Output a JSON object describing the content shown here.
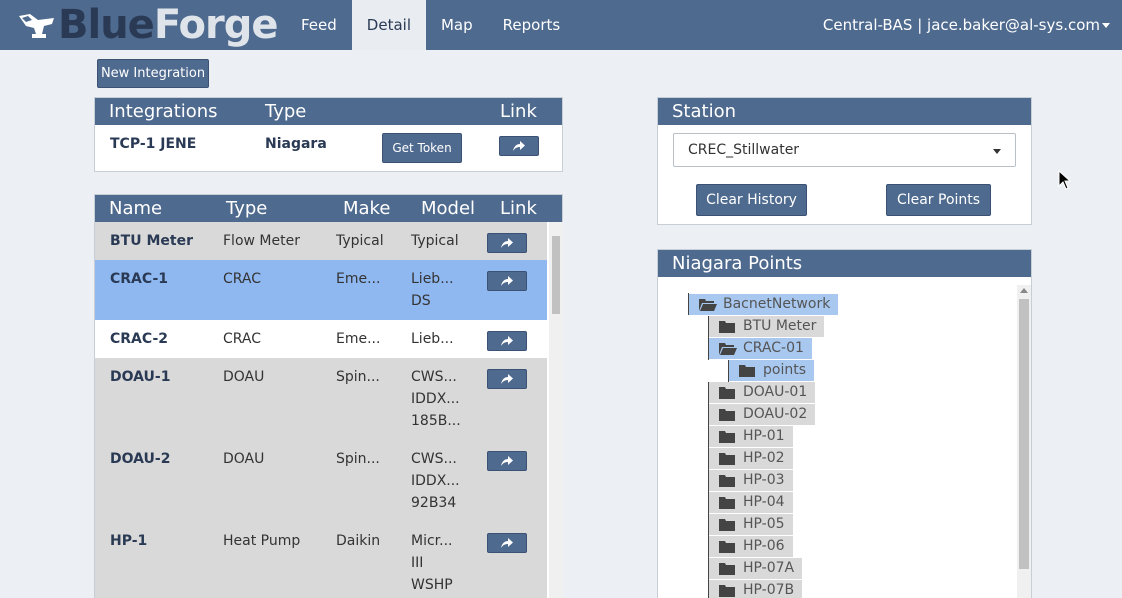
{
  "brand": {
    "part1": "Blue",
    "part2": "Forge"
  },
  "nav": {
    "tabs": [
      {
        "label": "Feed"
      },
      {
        "label": "Detail"
      },
      {
        "label": "Map"
      },
      {
        "label": "Reports"
      }
    ],
    "active": "Detail",
    "user": "Central-BAS | jace.baker@al-sys.com"
  },
  "new_integration_label": "New Integration",
  "integrations": {
    "headers": [
      "Integrations",
      "Type",
      "Link"
    ],
    "row": {
      "name": "TCP-1 JENE",
      "type": "Niagara",
      "token_label": "Get Token"
    }
  },
  "equipment": {
    "headers": [
      "Name",
      "Type",
      "Make",
      "Model",
      "Link"
    ],
    "rows": [
      {
        "name": "BTU Meter",
        "type": "Flow Meter",
        "make": "Typical",
        "model": [
          "Typical"
        ],
        "state": "default"
      },
      {
        "name": "CRAC-1",
        "type": "CRAC",
        "make": "Eme...",
        "model": [
          "Lieb...",
          "DS"
        ],
        "state": "selected"
      },
      {
        "name": "CRAC-2",
        "type": "CRAC",
        "make": "Eme...",
        "model": [
          "Lieb..."
        ],
        "state": "hover"
      },
      {
        "name": "DOAU-1",
        "type": "DOAU",
        "make": "Spin...",
        "model": [
          "CWS...",
          "IDDX...",
          "185B..."
        ],
        "state": "default"
      },
      {
        "name": "DOAU-2",
        "type": "DOAU",
        "make": "Spin...",
        "model": [
          "CWS...",
          "IDDX...",
          "92B34"
        ],
        "state": "default"
      },
      {
        "name": "HP-1",
        "type": "Heat Pump",
        "make": "Daikin",
        "model": [
          "Micr...",
          "III",
          "WSHP"
        ],
        "state": "default"
      }
    ]
  },
  "station": {
    "title": "Station",
    "selected": "CREC_Stillwater",
    "clear_history": "Clear History",
    "clear_points": "Clear Points"
  },
  "niagara": {
    "title": "Niagara Points",
    "root": "BacnetNetwork",
    "children": [
      "BTU Meter",
      "CRAC-01",
      "DOAU-01",
      "DOAU-02",
      "HP-01",
      "HP-02",
      "HP-03",
      "HP-04",
      "HP-05",
      "HP-06",
      "HP-07A",
      "HP-07B"
    ],
    "open_child": "CRAC-01",
    "grandchild": "points"
  },
  "colors": {
    "nav": "#4f6a8f",
    "selected_row": "#8fb8f0",
    "tree_selected": "#a8c8f0",
    "row_gray": "#d9d9d9"
  }
}
